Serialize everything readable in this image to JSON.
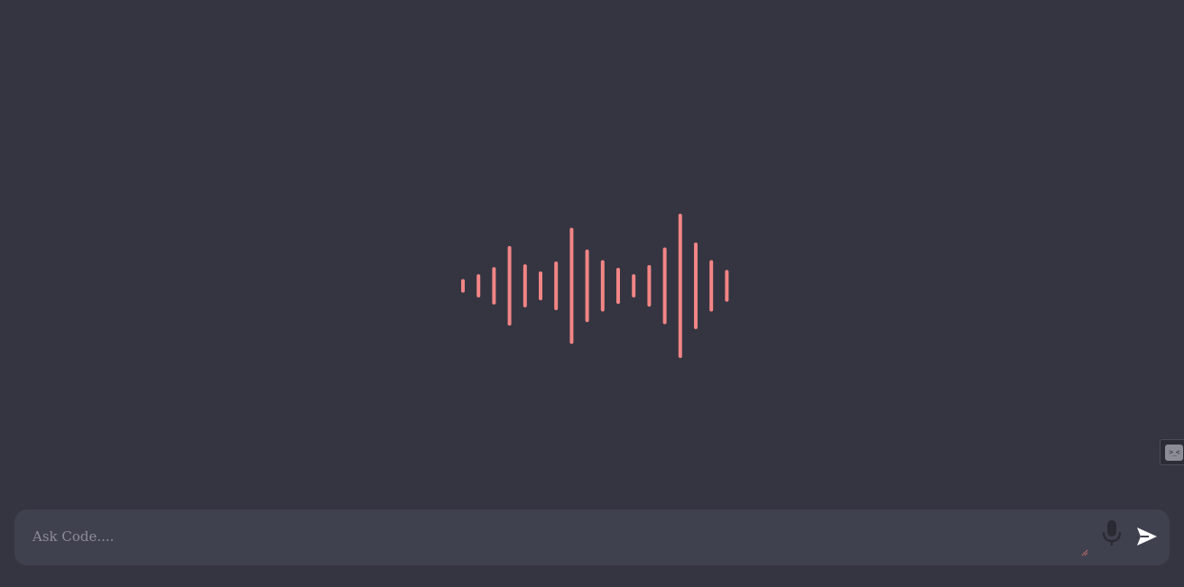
{
  "input": {
    "placeholder": "Ask Code....",
    "value": ""
  },
  "side_widget": {
    "glyph": ">_<"
  },
  "icons": {
    "mic": "microphone-icon",
    "send": "send-icon",
    "waveform": "audio-waveform-icon",
    "side": "terminal-icon"
  },
  "colors": {
    "background": "#353541",
    "input_bar": "#40414f",
    "waveform": "#f28585",
    "placeholder": "#8d8d99",
    "icon_mic": "#2a2a33",
    "icon_send": "#ffffff"
  },
  "waveform_levels": [
    0.07,
    0.14,
    0.24,
    0.54,
    0.28,
    0.18,
    0.32,
    0.8,
    0.49,
    0.34,
    0.23,
    0.14,
    0.27,
    0.52,
    1.0,
    0.59,
    0.34,
    0.2
  ]
}
